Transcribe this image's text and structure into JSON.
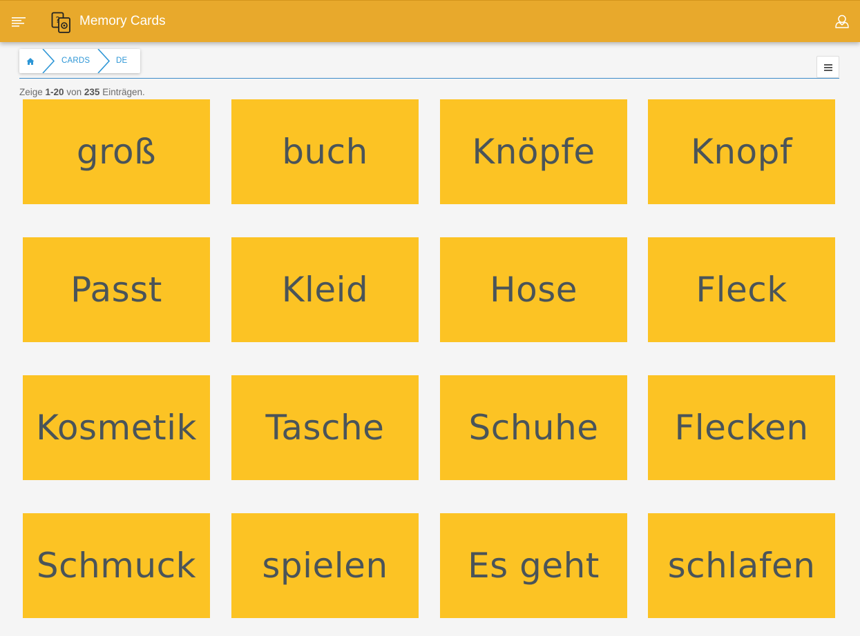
{
  "app": {
    "title": "Memory Cards"
  },
  "breadcrumb": {
    "items": [
      "CARDS",
      "DE"
    ]
  },
  "summary": {
    "prefix": "Zeige",
    "range": "1-20",
    "middle": "von",
    "total": "235",
    "suffix": "Einträgen."
  },
  "cards": [
    "groß",
    "buch",
    "Knöpfe",
    "Knopf",
    "Passt",
    "Kleid",
    "Hose",
    "Fleck",
    "Kosmetik",
    "Tasche",
    "Schuhe",
    "Flecken",
    "Schmuck",
    "spielen",
    "Es geht",
    "schlafen"
  ],
  "colors": {
    "header": "#e8a92c",
    "card": "#fcc324",
    "card_text": "#4a5459",
    "link": "#2d96d6"
  }
}
